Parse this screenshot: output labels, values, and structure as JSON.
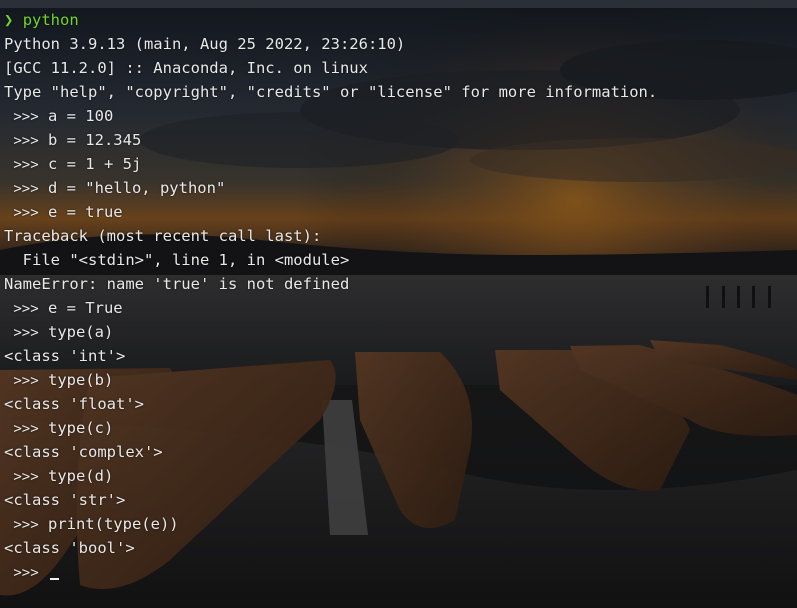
{
  "shell": {
    "prompt_symbol": "❯",
    "command": "python"
  },
  "python_prompt": ">>>",
  "lines": [
    {
      "kind": "output",
      "text": "Python 3.9.13 (main, Aug 25 2022, 23:26:10)"
    },
    {
      "kind": "output",
      "text": "[GCC 11.2.0] :: Anaconda, Inc. on linux"
    },
    {
      "kind": "output",
      "text": "Type \"help\", \"copyright\", \"credits\" or \"license\" for more information."
    },
    {
      "kind": "input",
      "text": "a = 100"
    },
    {
      "kind": "input",
      "text": "b = 12.345"
    },
    {
      "kind": "input",
      "text": "c = 1 + 5j"
    },
    {
      "kind": "input",
      "text": "d = \"hello, python\""
    },
    {
      "kind": "input",
      "text": "e = true"
    },
    {
      "kind": "output",
      "text": "Traceback (most recent call last):"
    },
    {
      "kind": "output",
      "text": "  File \"<stdin>\", line 1, in <module>"
    },
    {
      "kind": "output",
      "text": "NameError: name 'true' is not defined"
    },
    {
      "kind": "input",
      "text": "e = True"
    },
    {
      "kind": "input",
      "text": "type(a)"
    },
    {
      "kind": "output",
      "text": "<class 'int'>"
    },
    {
      "kind": "input",
      "text": "type(b)"
    },
    {
      "kind": "output",
      "text": "<class 'float'>"
    },
    {
      "kind": "input",
      "text": "type(c)"
    },
    {
      "kind": "output",
      "text": "<class 'complex'>"
    },
    {
      "kind": "input",
      "text": "type(d)"
    },
    {
      "kind": "output",
      "text": "<class 'str'>"
    },
    {
      "kind": "input",
      "text": "print(type(e))"
    },
    {
      "kind": "output",
      "text": "<class 'bool'>"
    }
  ],
  "colors": {
    "prompt_green": "#6fd62b",
    "text": "#e8e8e8"
  }
}
